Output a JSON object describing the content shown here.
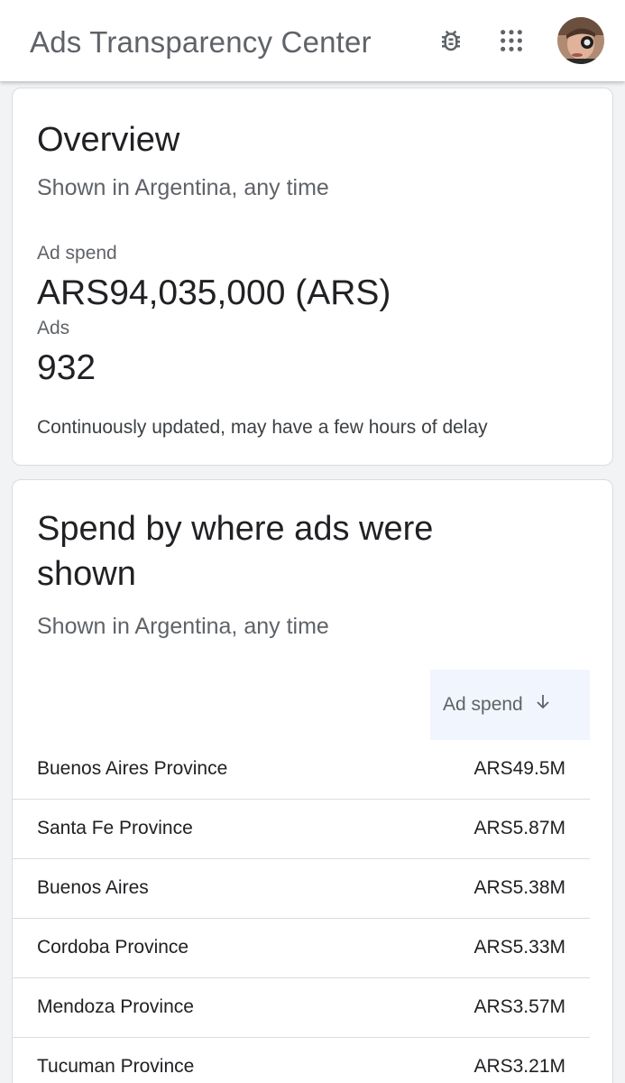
{
  "app_bar": {
    "title": "Ads Transparency Center",
    "icons": [
      "bug-report-icon",
      "apps-grid-icon"
    ],
    "avatar": "user-avatar"
  },
  "overview": {
    "title": "Overview",
    "subtitle": "Shown in Argentina, any time",
    "ad_spend_label": "Ad spend",
    "ad_spend_value": "ARS94,035,000 (ARS)",
    "ads_label": "Ads",
    "ads_value": "932",
    "note": "Continuously updated, may have a few hours of delay"
  },
  "spend_by_location": {
    "title_line1": "Spend by where ads were",
    "title_line2": "shown",
    "subtitle": "Shown in Argentina, any time",
    "column_header": "Ad spend",
    "sort_icon": "arrow-down-icon",
    "rows": [
      {
        "name": "Buenos Aires Province",
        "amount": "ARS49.5M"
      },
      {
        "name": "Santa Fe Province",
        "amount": "ARS5.87M"
      },
      {
        "name": "Buenos Aires",
        "amount": "ARS5.38M"
      },
      {
        "name": "Cordoba Province",
        "amount": "ARS5.33M"
      },
      {
        "name": "Mendoza Province",
        "amount": "ARS3.57M"
      },
      {
        "name": "Tucuman Province",
        "amount": "ARS3.21M"
      }
    ]
  },
  "colors": {
    "title_gray": "#5f6368",
    "text_dark": "#202124",
    "border": "#dadce0",
    "header_highlight": "#f1f5fd"
  }
}
